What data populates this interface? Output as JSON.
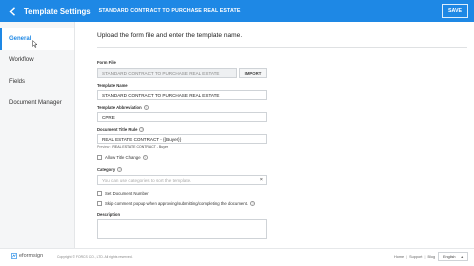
{
  "header": {
    "title": "Template Settings",
    "subtitle": "STANDARD CONTRACT TO PURCHASE REAL ESTATE",
    "save_label": "SAVE"
  },
  "sidebar": {
    "items": [
      {
        "label": "General"
      },
      {
        "label": "Workflow"
      },
      {
        "label": "Fields"
      },
      {
        "label": "Document Manager"
      }
    ]
  },
  "main": {
    "heading": "Upload the form file and enter the template name.",
    "form_file": {
      "label": "Form File",
      "value": "STANDARD CONTRACT TO PURCHASE REAL ESTATE",
      "button": "IMPORT"
    },
    "template_name": {
      "label": "Template Name",
      "value": "STANDARD CONTRACT TO PURCHASE REAL ESTATE"
    },
    "template_abbreviation": {
      "label": "Template Abbreviation",
      "value": "CPRE"
    },
    "document_title_rule": {
      "label": "Document Title Rule",
      "value": "REAL ESTATE CONTRACT - {{Buyer}}"
    },
    "preview": {
      "prefix": "Preview :",
      "value": "REAL ESTATE CONTRACT - Buyer"
    },
    "allow_title_change": {
      "label": "Allow Title Change"
    },
    "category": {
      "label": "Category",
      "placeholder": "You can use categories to sort the template.",
      "clear": "×"
    },
    "set_document_number": {
      "label": "Set Document Number"
    },
    "skip_comment_popup": {
      "label": "Skip comment popup when approving/submitting/completing the document."
    },
    "description": {
      "label": "Description"
    }
  },
  "footer": {
    "logo_text": "eformsign",
    "copyright": "Copyright © FORCS CO., LTD. All rights reserved.",
    "links": [
      "Home",
      "Support",
      "Blog"
    ],
    "separator": "|",
    "language": "English",
    "language_caret": "▲"
  },
  "colors": {
    "brand": "#1e88e5",
    "sidebar_bg": "#f5f6f7"
  },
  "icons": {
    "back": "chevron-left-icon",
    "info": "info-icon",
    "cursor": "mouse-pointer-icon"
  }
}
